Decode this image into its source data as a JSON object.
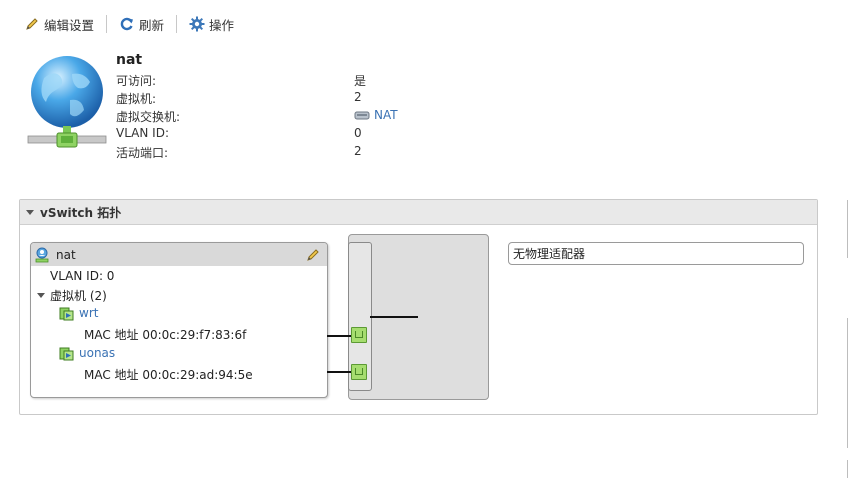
{
  "toolbar": {
    "edit_label": "编辑设置",
    "refresh_label": "刷新",
    "actions_label": "操作"
  },
  "header": {
    "title": "nat",
    "properties": [
      {
        "label": "可访问:",
        "value": "是"
      },
      {
        "label": "虚拟机:",
        "value": "2"
      },
      {
        "label": "虚拟交换机:",
        "value": "NAT"
      },
      {
        "label": "VLAN ID:",
        "value": "0"
      },
      {
        "label": "活动端口:",
        "value": "2"
      }
    ]
  },
  "topology": {
    "title": "vSwitch 拓扑",
    "portgroup": {
      "name": "nat",
      "vlan": "VLAN ID: 0",
      "vms_label": "虚拟机 (2)",
      "vms": [
        {
          "name": "wrt",
          "mac": "MAC 地址 00:0c:29:f7:83:6f"
        },
        {
          "name": "uonas",
          "mac": "MAC 地址 00:0c:29:ad:94:5e"
        }
      ]
    },
    "physical": "无物理适配器"
  },
  "colors": {
    "link": "#3a72b4",
    "port_green": "#a6dd6f",
    "panel_header": "#e9e9e9",
    "switch_gray": "#dedede"
  },
  "icons": {
    "edit": "pencil-icon",
    "refresh": "refresh-icon",
    "actions": "gear-icon",
    "network": "globe-network-icon",
    "vswitch": "vswitch-icon",
    "vm": "vm-icon"
  }
}
